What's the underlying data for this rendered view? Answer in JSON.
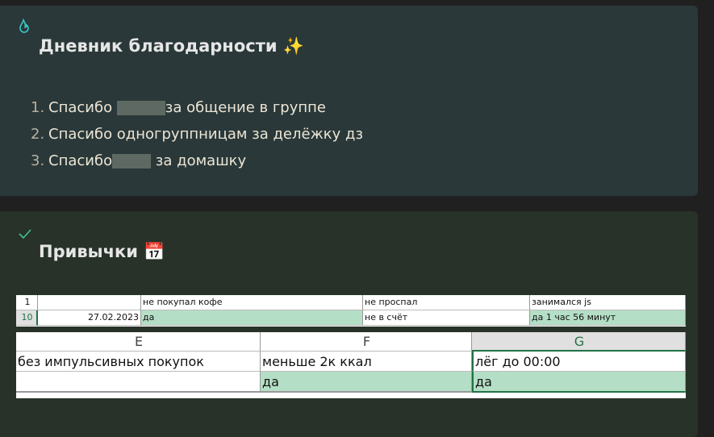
{
  "gratitude": {
    "icon": "flame-icon",
    "title": "Дневник благодарности",
    "title_emoji": "✨",
    "items": [
      {
        "num": "1.",
        "before": "Спасибо ",
        "after": "за общение в группе"
      },
      {
        "num": "2.",
        "before": "Спасибо одногруппницам за делёжку дз",
        "after": ""
      },
      {
        "num": "3.",
        "before": "Спасибо",
        "after": " за домашку"
      }
    ]
  },
  "habits": {
    "icon": "checkmark-icon",
    "title": "Привычки",
    "title_emoji": "📅",
    "sheet1": {
      "header_row": {
        "num": "1",
        "b": "",
        "c": "не покупал кофе",
        "d": "не проспал",
        "e": "занимался js"
      },
      "data_row": {
        "num": "10",
        "b": "27.02.2023",
        "c": "да",
        "d": "не в счёт",
        "e": "да 1 час 56 минут"
      }
    },
    "sheet2": {
      "columns": [
        "E",
        "F",
        "G"
      ],
      "header_row": [
        "без импульсивных покупок",
        "меньше 2к ккал",
        "лёг до 00:00"
      ],
      "data_row": [
        "",
        "да",
        "да"
      ]
    }
  },
  "colors": {
    "accent_green": "#217346",
    "cell_green": "#b4dfc6"
  }
}
